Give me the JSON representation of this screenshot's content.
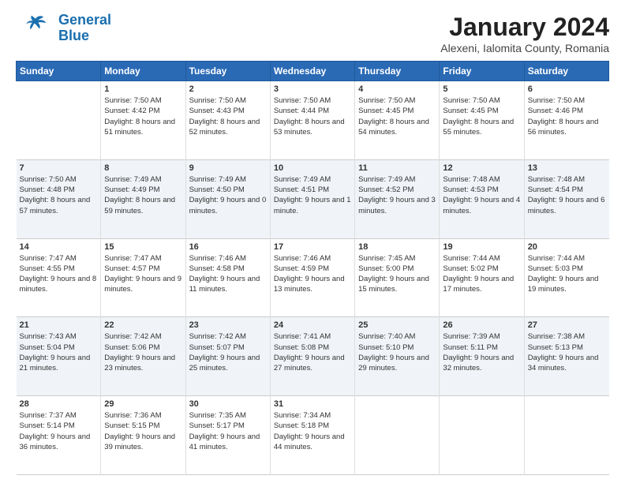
{
  "header": {
    "logo_general": "General",
    "logo_blue": "Blue",
    "month_title": "January 2024",
    "location": "Alexeni, Ialomita County, Romania"
  },
  "days_of_week": [
    "Sunday",
    "Monday",
    "Tuesday",
    "Wednesday",
    "Thursday",
    "Friday",
    "Saturday"
  ],
  "weeks": [
    [
      {
        "day": "",
        "sunrise": "",
        "sunset": "",
        "daylight": ""
      },
      {
        "day": "1",
        "sunrise": "Sunrise: 7:50 AM",
        "sunset": "Sunset: 4:42 PM",
        "daylight": "Daylight: 8 hours and 51 minutes."
      },
      {
        "day": "2",
        "sunrise": "Sunrise: 7:50 AM",
        "sunset": "Sunset: 4:43 PM",
        "daylight": "Daylight: 8 hours and 52 minutes."
      },
      {
        "day": "3",
        "sunrise": "Sunrise: 7:50 AM",
        "sunset": "Sunset: 4:44 PM",
        "daylight": "Daylight: 8 hours and 53 minutes."
      },
      {
        "day": "4",
        "sunrise": "Sunrise: 7:50 AM",
        "sunset": "Sunset: 4:45 PM",
        "daylight": "Daylight: 8 hours and 54 minutes."
      },
      {
        "day": "5",
        "sunrise": "Sunrise: 7:50 AM",
        "sunset": "Sunset: 4:45 PM",
        "daylight": "Daylight: 8 hours and 55 minutes."
      },
      {
        "day": "6",
        "sunrise": "Sunrise: 7:50 AM",
        "sunset": "Sunset: 4:46 PM",
        "daylight": "Daylight: 8 hours and 56 minutes."
      }
    ],
    [
      {
        "day": "7",
        "sunrise": "Sunrise: 7:50 AM",
        "sunset": "Sunset: 4:48 PM",
        "daylight": "Daylight: 8 hours and 57 minutes."
      },
      {
        "day": "8",
        "sunrise": "Sunrise: 7:49 AM",
        "sunset": "Sunset: 4:49 PM",
        "daylight": "Daylight: 8 hours and 59 minutes."
      },
      {
        "day": "9",
        "sunrise": "Sunrise: 7:49 AM",
        "sunset": "Sunset: 4:50 PM",
        "daylight": "Daylight: 9 hours and 0 minutes."
      },
      {
        "day": "10",
        "sunrise": "Sunrise: 7:49 AM",
        "sunset": "Sunset: 4:51 PM",
        "daylight": "Daylight: 9 hours and 1 minute."
      },
      {
        "day": "11",
        "sunrise": "Sunrise: 7:49 AM",
        "sunset": "Sunset: 4:52 PM",
        "daylight": "Daylight: 9 hours and 3 minutes."
      },
      {
        "day": "12",
        "sunrise": "Sunrise: 7:48 AM",
        "sunset": "Sunset: 4:53 PM",
        "daylight": "Daylight: 9 hours and 4 minutes."
      },
      {
        "day": "13",
        "sunrise": "Sunrise: 7:48 AM",
        "sunset": "Sunset: 4:54 PM",
        "daylight": "Daylight: 9 hours and 6 minutes."
      }
    ],
    [
      {
        "day": "14",
        "sunrise": "Sunrise: 7:47 AM",
        "sunset": "Sunset: 4:55 PM",
        "daylight": "Daylight: 9 hours and 8 minutes."
      },
      {
        "day": "15",
        "sunrise": "Sunrise: 7:47 AM",
        "sunset": "Sunset: 4:57 PM",
        "daylight": "Daylight: 9 hours and 9 minutes."
      },
      {
        "day": "16",
        "sunrise": "Sunrise: 7:46 AM",
        "sunset": "Sunset: 4:58 PM",
        "daylight": "Daylight: 9 hours and 11 minutes."
      },
      {
        "day": "17",
        "sunrise": "Sunrise: 7:46 AM",
        "sunset": "Sunset: 4:59 PM",
        "daylight": "Daylight: 9 hours and 13 minutes."
      },
      {
        "day": "18",
        "sunrise": "Sunrise: 7:45 AM",
        "sunset": "Sunset: 5:00 PM",
        "daylight": "Daylight: 9 hours and 15 minutes."
      },
      {
        "day": "19",
        "sunrise": "Sunrise: 7:44 AM",
        "sunset": "Sunset: 5:02 PM",
        "daylight": "Daylight: 9 hours and 17 minutes."
      },
      {
        "day": "20",
        "sunrise": "Sunrise: 7:44 AM",
        "sunset": "Sunset: 5:03 PM",
        "daylight": "Daylight: 9 hours and 19 minutes."
      }
    ],
    [
      {
        "day": "21",
        "sunrise": "Sunrise: 7:43 AM",
        "sunset": "Sunset: 5:04 PM",
        "daylight": "Daylight: 9 hours and 21 minutes."
      },
      {
        "day": "22",
        "sunrise": "Sunrise: 7:42 AM",
        "sunset": "Sunset: 5:06 PM",
        "daylight": "Daylight: 9 hours and 23 minutes."
      },
      {
        "day": "23",
        "sunrise": "Sunrise: 7:42 AM",
        "sunset": "Sunset: 5:07 PM",
        "daylight": "Daylight: 9 hours and 25 minutes."
      },
      {
        "day": "24",
        "sunrise": "Sunrise: 7:41 AM",
        "sunset": "Sunset: 5:08 PM",
        "daylight": "Daylight: 9 hours and 27 minutes."
      },
      {
        "day": "25",
        "sunrise": "Sunrise: 7:40 AM",
        "sunset": "Sunset: 5:10 PM",
        "daylight": "Daylight: 9 hours and 29 minutes."
      },
      {
        "day": "26",
        "sunrise": "Sunrise: 7:39 AM",
        "sunset": "Sunset: 5:11 PM",
        "daylight": "Daylight: 9 hours and 32 minutes."
      },
      {
        "day": "27",
        "sunrise": "Sunrise: 7:38 AM",
        "sunset": "Sunset: 5:13 PM",
        "daylight": "Daylight: 9 hours and 34 minutes."
      }
    ],
    [
      {
        "day": "28",
        "sunrise": "Sunrise: 7:37 AM",
        "sunset": "Sunset: 5:14 PM",
        "daylight": "Daylight: 9 hours and 36 minutes."
      },
      {
        "day": "29",
        "sunrise": "Sunrise: 7:36 AM",
        "sunset": "Sunset: 5:15 PM",
        "daylight": "Daylight: 9 hours and 39 minutes."
      },
      {
        "day": "30",
        "sunrise": "Sunrise: 7:35 AM",
        "sunset": "Sunset: 5:17 PM",
        "daylight": "Daylight: 9 hours and 41 minutes."
      },
      {
        "day": "31",
        "sunrise": "Sunrise: 7:34 AM",
        "sunset": "Sunset: 5:18 PM",
        "daylight": "Daylight: 9 hours and 44 minutes."
      },
      {
        "day": "",
        "sunrise": "",
        "sunset": "",
        "daylight": ""
      },
      {
        "day": "",
        "sunrise": "",
        "sunset": "",
        "daylight": ""
      },
      {
        "day": "",
        "sunrise": "",
        "sunset": "",
        "daylight": ""
      }
    ]
  ]
}
